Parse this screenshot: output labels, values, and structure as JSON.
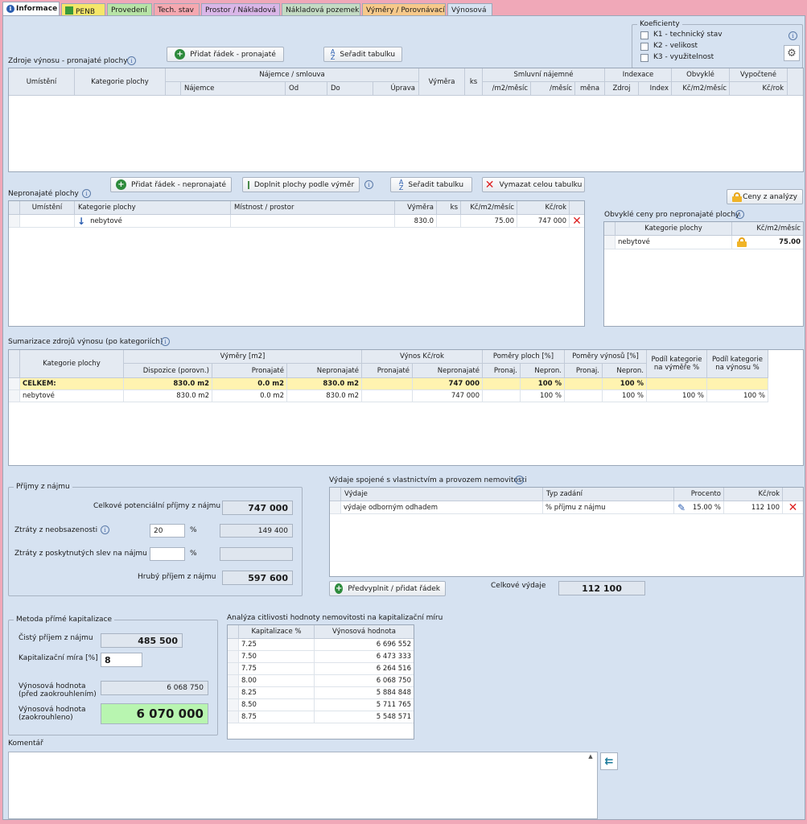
{
  "tabs": [
    {
      "label": "Informace",
      "bg": "#ffffff",
      "icon": "info-circle-icon"
    },
    {
      "label": "PENB",
      "bg": "#f5e66a",
      "icon": "penb-icon"
    },
    {
      "label": "Provedení",
      "bg": "#b7e3a6"
    },
    {
      "label": "Tech. stav",
      "bg": "#f5a8b0"
    },
    {
      "label": "Prostor / Nákladová",
      "bg": "#d9b6e8"
    },
    {
      "label": "Nákladová pozemek",
      "bg": "#c4dbc4"
    },
    {
      "label": "Výměry / Porovnávací",
      "bg": "#f7c98a"
    },
    {
      "label": "Výnosová",
      "bg": "#d6e2f1"
    }
  ],
  "koef": {
    "title": "Koeficienty",
    "items": [
      "K1 - technický stav",
      "K2 - velikost",
      "K3 - využitelnost"
    ]
  },
  "rent": {
    "title": "Zdroje výnosu - pronajaté plochy",
    "btn_add": "Přidat řádek - pronajaté",
    "btn_sort": "Seřadit tabulku",
    "h": {
      "umisteni": "Umístění",
      "kategorie": "Kategorie plochy",
      "najemce_smlouva": "Nájemce / smlouva",
      "najemce": "Nájemce",
      "od": "Od",
      "do": "Do",
      "uprava": "Úprava",
      "vymera": "Výměra",
      "ks": "ks",
      "smluvni": "Smluvní nájemné",
      "m2mesic": "/m2/měsíc",
      "mesic": "/měsíc",
      "mena": "měna",
      "indexace": "Indexace",
      "zdroj": "Zdroj",
      "index": "Index",
      "obvykle": "Obvyklé",
      "kcm2": "Kč/m2/měsíc",
      "vypoctene": "Vypočtené",
      "kcrok": "Kč/rok"
    }
  },
  "nonrent": {
    "title": "Nepronajaté plochy",
    "btn_add": "Přidat řádek - nepronajaté",
    "btn_fill": "Doplnit plochy podle výměr",
    "btn_sort": "Seřadit tabulku",
    "btn_clear": "Vymazat celou tabulku",
    "h": {
      "umisteni": "Umístění",
      "kategorie": "Kategorie plochy",
      "mistnost": "Místnost / prostor",
      "vymera": "Výměra",
      "ks": "ks",
      "kcm2": "Kč/m2/měsíc",
      "kcrok": "Kč/rok"
    },
    "row": {
      "umisteni": "",
      "kategorie": "nebytové",
      "mistnost": "",
      "vymera": "830.0",
      "ks": "",
      "kcm2": "75.00",
      "kcrok": "747 000"
    }
  },
  "prices": {
    "btn": "Ceny z analýzy",
    "title": "Obvyklé ceny pro nepronajaté plochy",
    "h": {
      "kategorie": "Kategorie plochy",
      "kcm2": "Kč/m2/měsíc"
    },
    "row": {
      "kategorie": "nebytové",
      "kcm2": "75.00"
    }
  },
  "summary": {
    "title": "Sumarizace zdrojů výnosu (po kategoriích)",
    "h": {
      "kategorie": "Kategorie plochy",
      "vymery": "Výměry [m2]",
      "dispozice": "Dispozice (porovn.)",
      "pronajate": "Pronajaté",
      "nepronajate": "Nepronajaté",
      "vynos": "Výnos Kč/rok",
      "vynos_pron": "Pronajaté",
      "vynos_nepron": "Nepronajaté",
      "pomery_ploch": "Poměry ploch [%]",
      "pronaj": "Pronaj.",
      "nepron": "Nepron.",
      "pomery_vynosu": "Poměry výnosů [%]",
      "pronaj2": "Pronaj.",
      "nepron2": "Nepron.",
      "podil_vym": "Podíl kategorie\nna výměře %",
      "podil_vyn": "Podíl kategorie\nna výnosu %"
    },
    "rows": [
      {
        "kategorie": "CELKEM:",
        "dispozice": "830.0 m2",
        "pronajate": "0.0 m2",
        "nepronajate": "830.0 m2",
        "vynos_pron": "",
        "vynos_nepron": "747 000",
        "pronaj": "",
        "nepron": "100 %",
        "pronaj2": "",
        "nepron2": "100 %",
        "podil_vym": "",
        "podil_vyn": ""
      },
      {
        "kategorie": "nebytové",
        "dispozice": "830.0 m2",
        "pronajate": "0.0 m2",
        "nepronajate": "830.0 m2",
        "vynos_pron": "",
        "vynos_nepron": "747 000",
        "pronaj": "",
        "nepron": "100 %",
        "pronaj2": "",
        "nepron2": "100 %",
        "podil_vym": "100 %",
        "podil_vyn": "100 %"
      }
    ]
  },
  "income": {
    "title": "Příjmy z nájmu",
    "potential_label": "Celkové potenciální příjmy z nájmu",
    "potential": "747 000",
    "vacancy_label": "Ztráty z neobsazenosti",
    "vacancy_pct": "20",
    "vacancy_unit": "%",
    "vacancy_val": "149 400",
    "discount_label": "Ztráty z poskytnutých slev na nájmu",
    "discount_pct": "",
    "discount_unit": "%",
    "discount_val": "",
    "gross_label": "Hrubý příjem z nájmu",
    "gross": "597 600"
  },
  "expenses": {
    "title": "Výdaje spojené s vlastnictvím a provozem nemovitosti",
    "h": {
      "vydaje": "Výdaje",
      "typ": "Typ zadání",
      "procento": "Procento",
      "kcrok": "Kč/rok"
    },
    "row": {
      "vydaje": "výdaje odborným odhadem",
      "typ": "% příjmu z nájmu",
      "procento": "15.00 %",
      "kcrok": "112 100"
    },
    "btn_prefill": "Předvyplnit / přidat řádek",
    "total_label": "Celkové výdaje",
    "total": "112 100"
  },
  "capital": {
    "title": "Metoda přímé kapitalizace",
    "net_label": "Čistý příjem z nájmu",
    "net": "485 500",
    "rate_label": "Kapitalizační míra [%]",
    "rate": "8",
    "value_label_1": "Výnosová hodnota",
    "value_label_2": "(před zaokrouhlením)",
    "value": "6 068 750",
    "rounded_label_1": "Výnosová hodnota",
    "rounded_label_2": "(zaokrouhleno)",
    "rounded": "6 070 000"
  },
  "sensitivity": {
    "title": "Analýza citlivosti hodnoty nemovitosti na kapitalizační míru",
    "h": {
      "kap": "Kapitalizace %",
      "hodnota": "Výnosová hodnota"
    },
    "rows": [
      {
        "kap": "7.25",
        "hodnota": "6 696 552"
      },
      {
        "kap": "7.50",
        "hodnota": "6 473 333"
      },
      {
        "kap": "7.75",
        "hodnota": "6 264 516"
      },
      {
        "kap": "8.00",
        "hodnota": "6 068 750"
      },
      {
        "kap": "8.25",
        "hodnota": "5 884 848"
      },
      {
        "kap": "8.50",
        "hodnota": "5 711 765"
      },
      {
        "kap": "8.75",
        "hodnota": "5 548 571"
      }
    ]
  },
  "comment": {
    "title": "Komentář",
    "value": ""
  }
}
